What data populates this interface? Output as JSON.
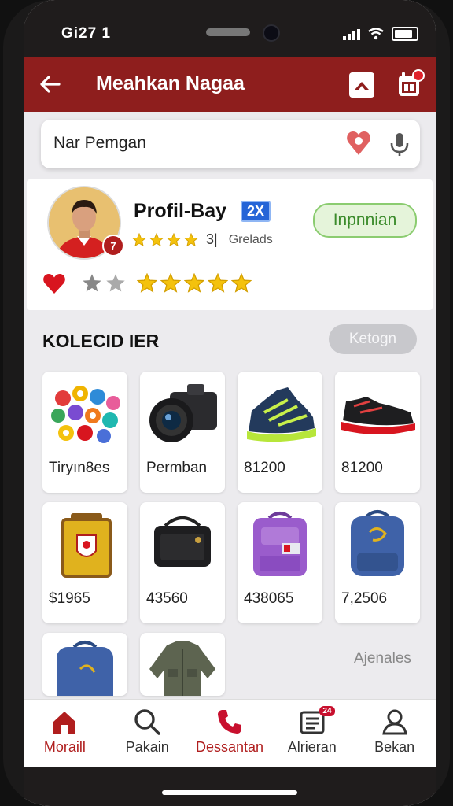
{
  "status_bar": {
    "time": "Gi27 1"
  },
  "header": {
    "title": "Meahkan Nagaa"
  },
  "search": {
    "text": "Nar Pemgan"
  },
  "profile": {
    "name": "Profil-Bay",
    "badge": "2X",
    "avatar_badge": "7",
    "rating_value": "3|",
    "rating_label": "Grelads",
    "follow_label": "Inpnnian"
  },
  "section": {
    "title": "KOLECID IER",
    "action_label": "Ketogn"
  },
  "products": [
    {
      "label": "Tiryın8es",
      "icon": "badges-icon"
    },
    {
      "label": "Permban",
      "icon": "camera-icon"
    },
    {
      "label": "81200",
      "icon": "green-sneaker-icon"
    },
    {
      "label": "81200",
      "icon": "red-sneaker-icon"
    },
    {
      "label": "$1965",
      "icon": "yellow-backpack-icon"
    },
    {
      "label": "43560",
      "icon": "camera-bag-icon"
    },
    {
      "label": "438065",
      "icon": "purple-backpack-icon"
    },
    {
      "label": "7,2506",
      "icon": "blue-backpack-icon"
    },
    {
      "label": "",
      "icon": "blue-backpack-icon"
    },
    {
      "label": "",
      "icon": "jacket-icon"
    }
  ],
  "more_link": "Ajenales",
  "tabs": [
    {
      "label": "Moraill",
      "icon": "home-icon",
      "active": true
    },
    {
      "label": "Pakain",
      "icon": "search-icon",
      "active": false
    },
    {
      "label": "Dessantan",
      "icon": "phone-icon",
      "active": false
    },
    {
      "label": "Alrieran",
      "icon": "list-icon",
      "active": false,
      "badge": "24"
    },
    {
      "label": "Bekan",
      "icon": "user-icon",
      "active": false
    }
  ],
  "colors": {
    "header": "#8e1e1d",
    "accent": "#b01e1e",
    "star": "#f4c20d",
    "follow_bg": "#e5f4da",
    "follow_text": "#3b8b2b"
  }
}
